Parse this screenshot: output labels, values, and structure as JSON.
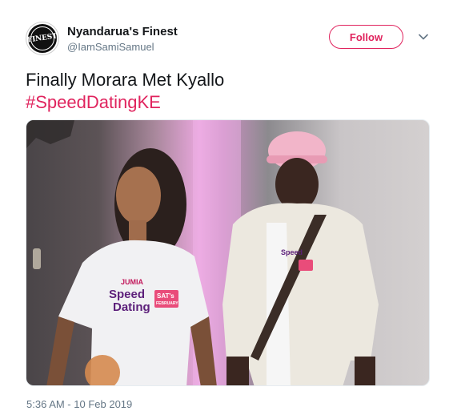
{
  "author": {
    "display_name": "Nyandarua's Finest",
    "handle": "@IamSamiSamuel",
    "avatar_text": "FINEST"
  },
  "actions": {
    "follow_label": "Follow",
    "more_icon": "chevron-down-icon"
  },
  "tweet": {
    "text_line1": "Finally Morara Met Kyallo",
    "hashtag": "#SpeedDatingKE"
  },
  "media": {
    "shirt_brand": "JUMIA",
    "shirt_line1": "Speed",
    "shirt_line2": "Dating",
    "shirt_badge": "SAT's",
    "shirt_badge_sub": "FEBRUARY"
  },
  "timestamp": "5:36 AM - 10 Feb 2019",
  "colors": {
    "accent": "#e0245e",
    "secondary_text": "#657786",
    "primary_text": "#14171a"
  }
}
